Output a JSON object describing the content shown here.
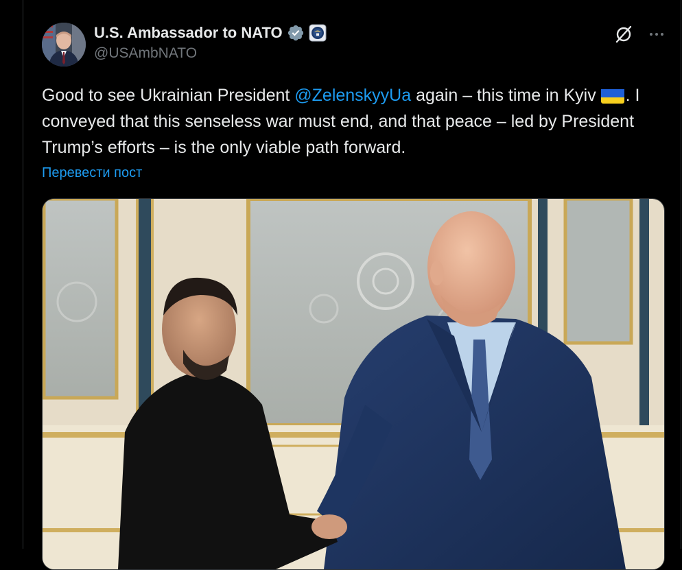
{
  "author": {
    "display_name": "U.S. Ambassador to NATO",
    "handle": "@USAmbNATO",
    "avatar_icon": "profile-photo",
    "verified_icon": "verified-badge-icon",
    "affiliation_icon": "government-seal-icon"
  },
  "actions": {
    "grok_icon": "grok-icon",
    "more_icon": "more-options-icon"
  },
  "tweet": {
    "text_before": "Good to see Ukrainian President ",
    "mention": "@ZelenskyyUa",
    "text_after_mention": " again – this time in Kyiv ",
    "flag": "Ukraine flag emoji",
    "text_end": ". I conveyed that this senseless war must end, and that peace – led by President Trump’s efforts – is the only viable path forward."
  },
  "translate_label": "Перевести пост",
  "media": {
    "icon": "photo"
  },
  "colors": {
    "background": "#000000",
    "text": "#e7e9ea",
    "secondary": "#71767b",
    "link": "#1d9bf0"
  }
}
